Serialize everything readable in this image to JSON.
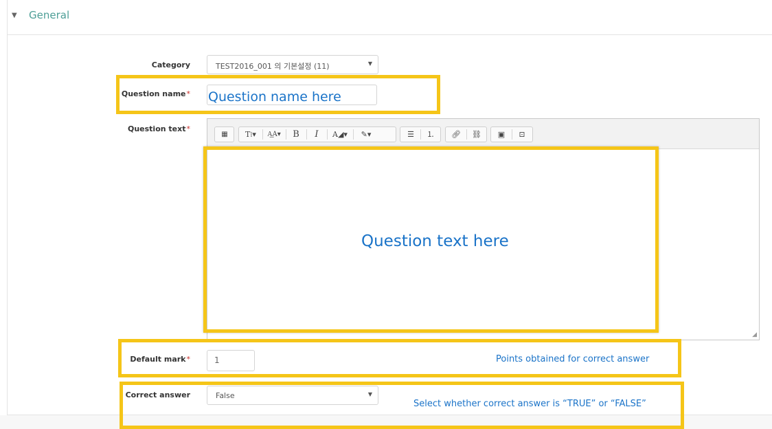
{
  "section": {
    "title": "General",
    "collapse_icon": "triangle-down"
  },
  "form": {
    "category": {
      "label": "Category",
      "value": "TEST2016_001 의 기본설정 (11)"
    },
    "question_name": {
      "label": "Question name",
      "required_mark": "*",
      "value": "Question name here"
    },
    "question_text": {
      "label": "Question text",
      "required_mark": "*",
      "value": "Question text here",
      "toolbar": [
        "toolbar-toggle-icon",
        "paragraph-style-icon",
        "font-size-icon",
        "bold-icon",
        "italic-icon",
        "font-color-icon",
        "highlight-color-icon",
        "unordered-list-icon",
        "ordered-list-icon",
        "link-icon",
        "unlink-icon",
        "image-icon",
        "media-icon"
      ]
    },
    "default_mark": {
      "label": "Default mark",
      "required_mark": "*",
      "value": "1"
    },
    "correct_answer": {
      "label": "Correct answer",
      "value": "False"
    }
  },
  "annotations": {
    "default_mark_note": "Points obtained for correct answer",
    "correct_answer_note": "Select whether correct answer is “TRUE” or “FALSE”"
  },
  "colors": {
    "highlight": "#f5c518",
    "annotation_text": "#1a73c8",
    "section_title": "#4d9e96",
    "required": "#c9302c"
  }
}
